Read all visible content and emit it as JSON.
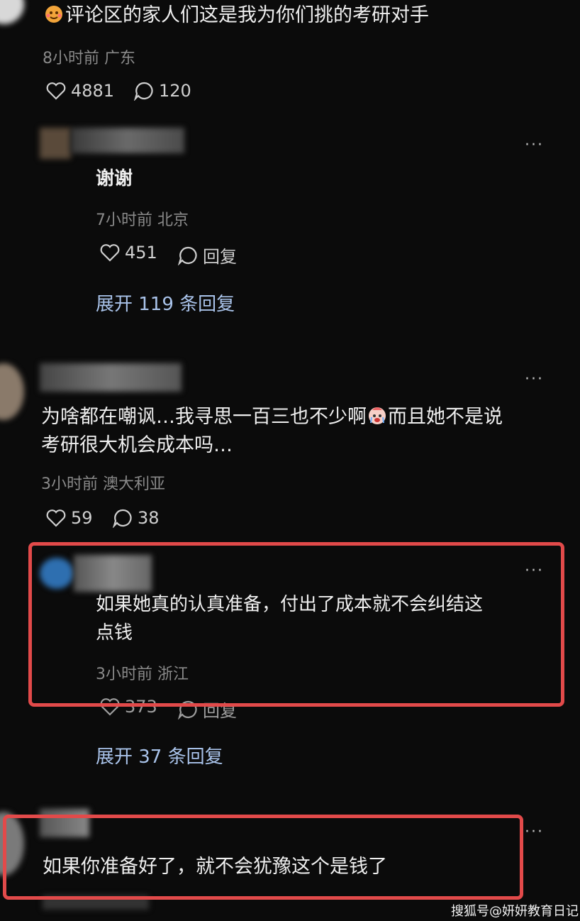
{
  "comments": [
    {
      "text": "评论区的家人们这是我为你们挑的考研对手",
      "emoji": "face-icon",
      "meta": "8小时前 广东",
      "likes": "4881",
      "replies": "120"
    },
    {
      "reply": true,
      "text": "谢谢",
      "meta": "7小时前 北京",
      "likes": "451",
      "reply_label": "回复",
      "expand": "展开 119 条回复"
    },
    {
      "text_line1": "为啥都在嘲讽…我寻思一百三也不少啊",
      "text_line1b": "而且她不是说",
      "text_line2": "考研很大机会成本吗…",
      "meta": "3小时前 澳大利亚",
      "likes": "59",
      "replies": "38"
    },
    {
      "reply": true,
      "text_line1": "如果她真的认真准备，付出了成本就不会纠结这",
      "text_line2": "点钱",
      "meta": "3小时前 浙江",
      "likes": "373",
      "reply_label": "回复",
      "expand": "展开 37 条回复"
    },
    {
      "text": "如果你准备好了，就不会犹豫这个是钱了"
    }
  ],
  "more_label": "···",
  "watermark": "搜狐号@妍妍教育日记",
  "colors": {
    "highlight": "#e24a4a",
    "link": "#a9c3ea",
    "bg": "#0b0b0b"
  }
}
